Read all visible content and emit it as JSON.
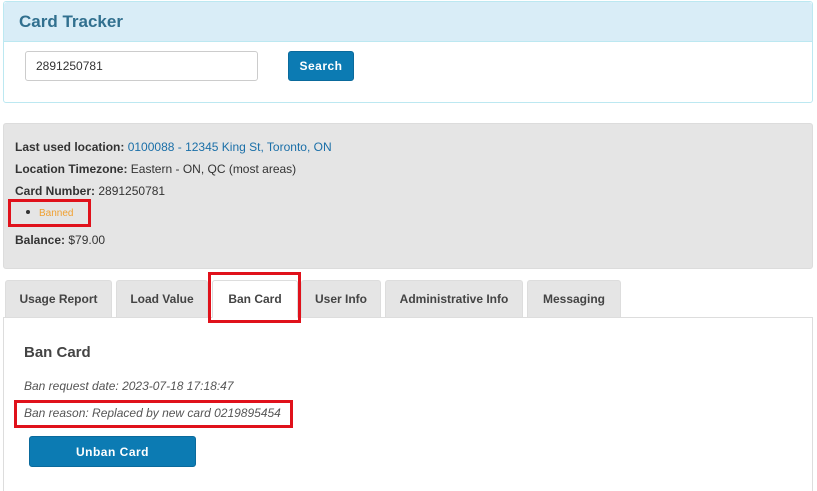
{
  "tracker": {
    "title": "Card Tracker",
    "search_value": "2891250781",
    "search_button": "Search"
  },
  "info": {
    "last_location_label": "Last used location:",
    "last_location_value": "0100088 - 12345 King St, Toronto, ON",
    "timezone_label": "Location Timezone:",
    "timezone_value": "Eastern - ON, QC (most areas)",
    "card_number_label": "Card Number:",
    "card_number_value": "2891250781",
    "status": "Banned",
    "balance_label": "Balance:",
    "balance_value": "$79.00"
  },
  "tabs": [
    {
      "label": "Usage Report"
    },
    {
      "label": "Load Value"
    },
    {
      "label": "Ban Card"
    },
    {
      "label": "User Info"
    },
    {
      "label": "Administrative Info"
    },
    {
      "label": "Messaging"
    }
  ],
  "active_tab": "Ban Card",
  "ban_card": {
    "title": "Ban Card",
    "request_date": "Ban request date: 2023-07-18 17:18:47",
    "reason": "Ban reason: Replaced by new card 0219895454",
    "unban_button": "Unban Card"
  },
  "colors": {
    "accent": "#0c7bb3",
    "header_bg": "#d9edf7",
    "header_text": "#31708f",
    "status_banned": "#f0a030",
    "annotation": "#e0111b"
  }
}
